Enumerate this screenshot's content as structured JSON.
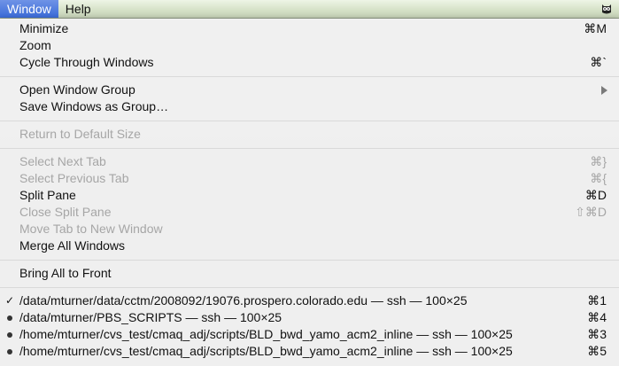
{
  "menubar": {
    "menus": [
      "Window",
      "Help"
    ],
    "status_icon": "owl-icon"
  },
  "window_menu": {
    "items": [
      {
        "label": "Minimize",
        "shortcut": "⌘M",
        "enabled": true
      },
      {
        "label": "Zoom",
        "shortcut": "",
        "enabled": true
      },
      {
        "label": "Cycle Through Windows",
        "shortcut": "⌘`",
        "enabled": true
      },
      {
        "label": "Open Window Group",
        "shortcut": "",
        "enabled": true,
        "submenu": true
      },
      {
        "label": "Save Windows as Group…",
        "shortcut": "",
        "enabled": true
      },
      {
        "label": "Return to Default Size",
        "shortcut": "",
        "enabled": false
      },
      {
        "label": "Select Next Tab",
        "shortcut": "⌘}",
        "enabled": false
      },
      {
        "label": "Select Previous Tab",
        "shortcut": "⌘{",
        "enabled": false
      },
      {
        "label": "Split Pane",
        "shortcut": "⌘D",
        "enabled": true
      },
      {
        "label": "Close Split Pane",
        "shortcut": "⇧⌘D",
        "enabled": false
      },
      {
        "label": "Move Tab to New Window",
        "shortcut": "",
        "enabled": false
      },
      {
        "label": "Merge All Windows",
        "shortcut": "",
        "enabled": true
      },
      {
        "label": "Bring All to Front",
        "shortcut": "",
        "enabled": true
      }
    ],
    "windows": [
      {
        "label": "/data/mturner/data/cctm/2008092/19076.prospero.colorado.edu — ssh — 100×25",
        "shortcut": "⌘1",
        "marker": "check"
      },
      {
        "label": "/data/mturner/PBS_SCRIPTS — ssh — 100×25",
        "shortcut": "⌘4",
        "marker": "bullet"
      },
      {
        "label": "/home/mturner/cvs_test/cmaq_adj/scripts/BLD_bwd_yamo_acm2_inline — ssh — 100×25",
        "shortcut": "⌘3",
        "marker": "bullet"
      },
      {
        "label": "/home/mturner/cvs_test/cmaq_adj/scripts/BLD_bwd_yamo_acm2_inline — ssh — 100×25",
        "shortcut": "⌘5",
        "marker": "bullet"
      }
    ],
    "check_glyph": "✓"
  }
}
